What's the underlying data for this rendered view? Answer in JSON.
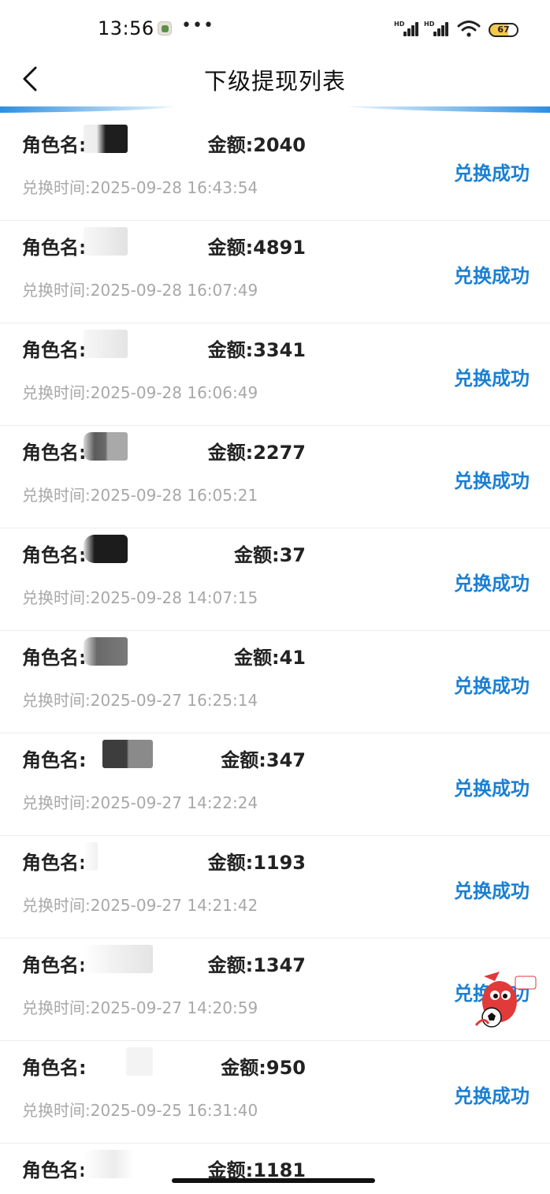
{
  "status_bar": {
    "time": "13:56",
    "dots": "•••",
    "hd_label": "HD",
    "battery": "67"
  },
  "nav": {
    "title": "下级提现列表"
  },
  "labels": {
    "role_prefix": "角色名:",
    "amount_prefix": "金额:",
    "time_prefix": "兑换时间:"
  },
  "rows": [
    {
      "amount": "2040",
      "time": "2025-09-28 16:43:54",
      "status": "兑换成功"
    },
    {
      "amount": "4891",
      "time": "2025-09-28 16:07:49",
      "status": "兑换成功"
    },
    {
      "amount": "3341",
      "time": "2025-09-28 16:06:49",
      "status": "兑换成功"
    },
    {
      "amount": "2277",
      "time": "2025-09-28 16:05:21",
      "status": "兑换成功"
    },
    {
      "amount": "37",
      "time": "2025-09-28 14:07:15",
      "status": "兑换成功"
    },
    {
      "amount": "41",
      "time": "2025-09-27 16:25:14",
      "status": "兑换成功"
    },
    {
      "amount": "347",
      "time": "2025-09-27 14:22:24",
      "status": "兑换成功"
    },
    {
      "amount": "1193",
      "time": "2025-09-27 14:21:42",
      "status": "兑换成功"
    },
    {
      "amount": "1347",
      "time": "2025-09-27 14:20:59",
      "status": "兑换成功"
    },
    {
      "amount": "950",
      "time": "2025-09-25 16:31:40",
      "status": "兑换成功"
    },
    {
      "amount": "1181",
      "time": "",
      "status": ""
    }
  ],
  "colors": {
    "status_link": "#1a7fd4",
    "time_text": "#a8a8a8",
    "accent_line": "#3aa0e8"
  }
}
